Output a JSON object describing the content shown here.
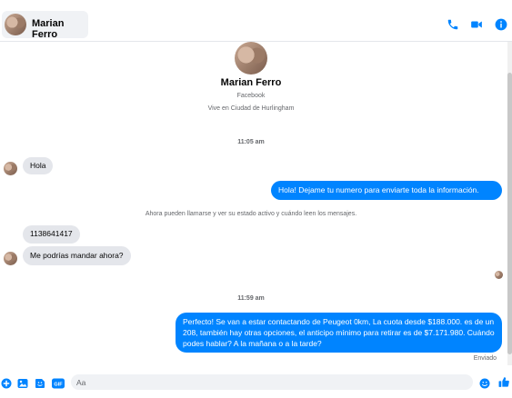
{
  "header": {
    "contact_name": "Marian Ferro"
  },
  "profile": {
    "name": "Marian Ferro",
    "source": "Facebook",
    "location": "Vive en Ciudad de Hurlingham"
  },
  "conversation": {
    "timestamp_1": "11:05 am",
    "msg_in_1": "Hola",
    "msg_out_1": "Hola! Dejame tu numero  para enviarte toda la información.",
    "notice": "Ahora pueden llamarse y ver su estado activo y cuándo leen los mensajes.",
    "msg_in_2": "1138641417",
    "msg_in_3": "Me podrías mandar ahora?",
    "timestamp_2": "11:59 am",
    "msg_out_2": "Perfecto!  Se van a estar contactando de Peugeot 0km, La cuota desde $188.000. es de un 208, también hay otras opciones, el anticipo mínimo para retirar es de $7.171.980. Cuándo podes hablar? A la mañana o a la tarde?",
    "status": "Enviado"
  },
  "composer": {
    "placeholder": "Aa"
  },
  "colors": {
    "accent": "#0084ff",
    "incoming_bubble": "#e4e6eb",
    "muted_text": "#65676b"
  },
  "icons": {
    "header": [
      "phone-icon",
      "video-camera-icon",
      "info-icon"
    ],
    "composer": [
      "plus-icon",
      "image-icon",
      "sticker-icon",
      "gif-icon",
      "emoji-icon",
      "thumbs-up-icon"
    ]
  }
}
